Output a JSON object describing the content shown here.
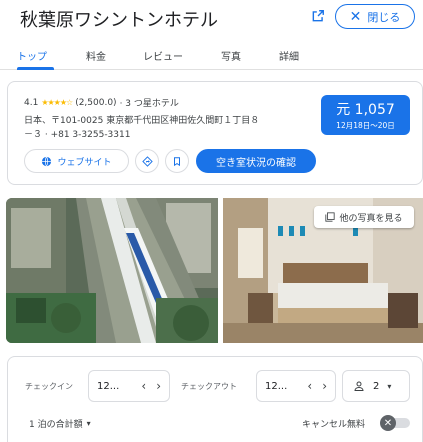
{
  "header": {
    "title": "秋葉原ワシントンホテル",
    "close_label": "閉じる"
  },
  "tabs": [
    {
      "label": "トップ",
      "active": true
    },
    {
      "label": "料金"
    },
    {
      "label": "レビュー"
    },
    {
      "label": "写真"
    },
    {
      "label": "詳細"
    }
  ],
  "info": {
    "rating": "4.1",
    "stars": "★★★★☆",
    "review_count": "(2,500.0)",
    "hotel_class": "· 3 つ星ホテル",
    "address_line1": "日本、〒101-0025 東京都千代田区神田佐久間町１丁目８",
    "address_line2": "－３ · +81 3-3255-3311",
    "price": "元 1,057",
    "dates": "12月18日～20日",
    "website_label": "ウェブサイト",
    "availability_label": "空き室状況の確認"
  },
  "photos": {
    "more_label": "他の写真を見る"
  },
  "booking": {
    "checkin_label": "チェックイン",
    "checkin_value": "12...",
    "checkout_label": "チェックアウト",
    "checkout_value": "12...",
    "guests_value": "2",
    "total_label": "1 泊の合計額",
    "cancel_label": "キャンセル無料"
  },
  "colors": {
    "accent": "#1a73e8",
    "star": "#fbbc04"
  }
}
